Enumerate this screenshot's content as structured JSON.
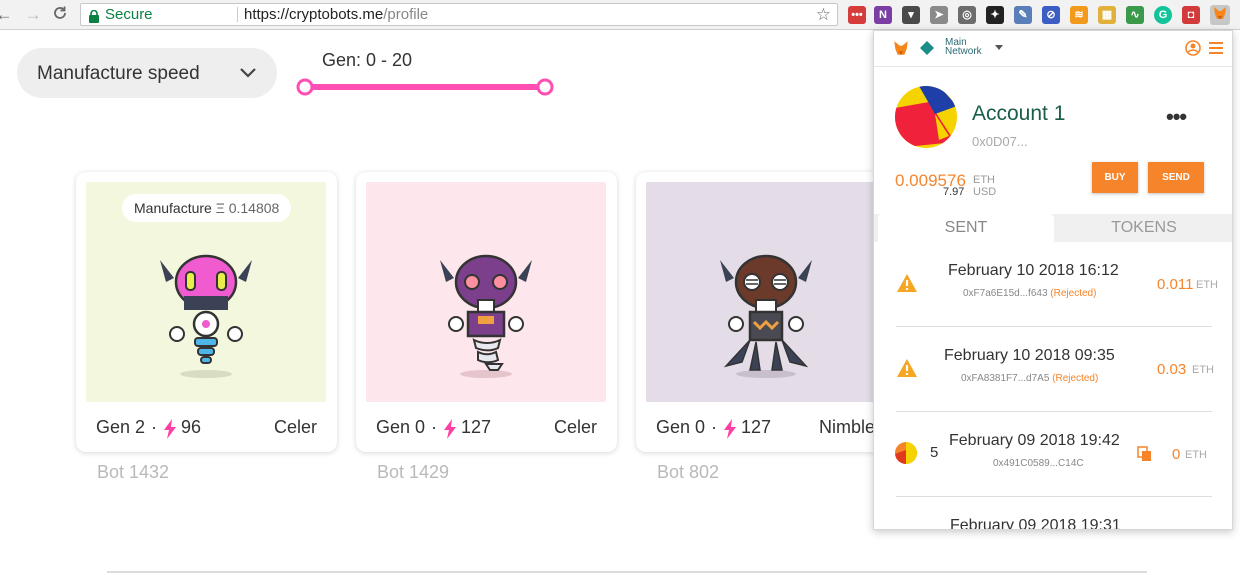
{
  "browser": {
    "secure_label": "Secure",
    "url_host": "https://cryptobots.me",
    "url_path": "/profile"
  },
  "filters": {
    "sort_label": "Manufacture speed",
    "gen_range_label": "Gen: 0 - 20",
    "gen_range": [
      0,
      20
    ],
    "accent": "#ff4fb4"
  },
  "cards": [
    {
      "manufacture_label": "Manufacture",
      "manufacture_price": "Ξ 0.14808",
      "gen": "Gen 2",
      "speed": "96",
      "trait": "Celer",
      "name": "Bot 1432",
      "bg": "#f2f7dd"
    },
    {
      "gen": "Gen 0",
      "speed": "127",
      "trait": "Celer",
      "name": "Bot 1429",
      "bg": "#fde7ec"
    },
    {
      "gen": "Gen 0",
      "speed": "127",
      "trait": "Nimble",
      "name": "Bot 802",
      "bg": "#e4dde7"
    }
  ],
  "wallet": {
    "network_line1": "Main",
    "network_line2": "Network",
    "account_name": "Account 1",
    "account_address": "0x0D07...",
    "balance_eth": "0.009576",
    "balance_eth_unit": "ETH",
    "balance_usd": "7.97",
    "balance_usd_unit": "USD",
    "buy_label": "BUY",
    "send_label": "SEND",
    "tab_sent": "SENT",
    "tab_tokens": "TOKENS",
    "transactions": [
      {
        "date": "February 10 2018 16:12",
        "hash": "0xF7a6E15d...f643",
        "status": "(Rejected)",
        "amount": "0.011",
        "unit": "ETH"
      },
      {
        "date": "February 10 2018 09:35",
        "hash": "0xFA8381F7...d7A5",
        "status": "(Rejected)",
        "amount": "0.03",
        "unit": "ETH"
      },
      {
        "nonce": "5",
        "date": "February 09 2018 19:42",
        "hash": "0x491C0589...C14C",
        "status": "",
        "amount": "0",
        "unit": "ETH"
      },
      {
        "date": "February 09 2018 19:31"
      }
    ]
  }
}
